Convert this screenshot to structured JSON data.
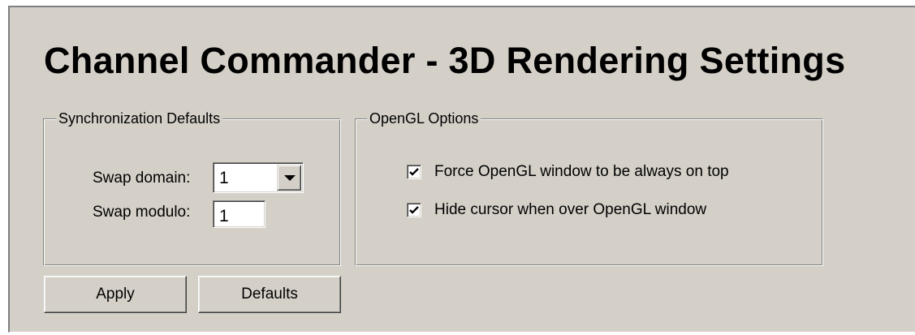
{
  "page": {
    "title": "Channel Commander - 3D Rendering Settings"
  },
  "sync_group": {
    "label": "Synchronization Defaults",
    "swap_domain_label": "Swap domain:",
    "swap_domain_value": "1",
    "swap_modulo_label": "Swap modulo:",
    "swap_modulo_value": "1"
  },
  "opengl_group": {
    "label": "OpenGL Options",
    "options": [
      {
        "label": "Force OpenGL window to be always on top",
        "checked": true
      },
      {
        "label": "Hide cursor when over OpenGL window",
        "checked": true
      }
    ]
  },
  "buttons": {
    "apply": "Apply",
    "defaults": "Defaults"
  },
  "icons": {
    "dropdown": "chevron-down-icon",
    "checked": "checkmark-icon"
  },
  "colors": {
    "panel_background": "#d4d0c8",
    "field_background": "#ffffff",
    "text": "#000000",
    "shadow": "#808080",
    "highlight": "#ffffff"
  }
}
